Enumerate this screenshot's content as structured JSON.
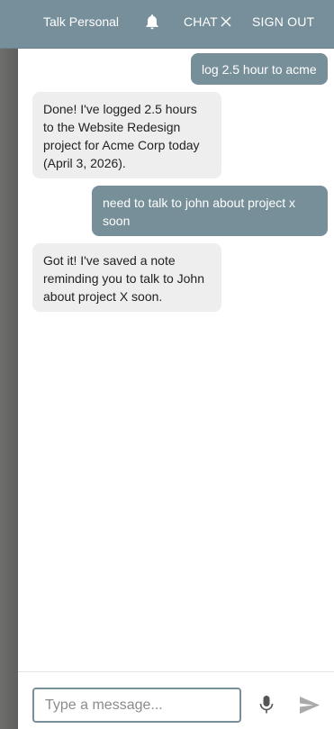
{
  "header": {
    "title": "Talk Personal",
    "notifications_icon": "bell-icon",
    "chat_label": "CHAT",
    "close_icon": "close-icon",
    "sign_out_label": "SIGN OUT"
  },
  "messages": [
    {
      "role": "user",
      "text": "log 2.5 hour to acme"
    },
    {
      "role": "assistant",
      "text": "Done! I've logged 2.5 hours to the Website Redesign project for Acme Corp today (April 3, 2026)."
    },
    {
      "role": "user",
      "text": "need to talk to john about project x soon"
    },
    {
      "role": "assistant",
      "text": "Got it! I've saved a note reminding you to talk to John about project X soon."
    }
  ],
  "composer": {
    "placeholder": "Type a message...",
    "value": "",
    "mic_icon": "microphone-icon",
    "send_icon": "send-icon"
  },
  "colors": {
    "header_bg": "#768f9a",
    "user_bubble": "#778f99",
    "assistant_bubble": "#eeeeee",
    "panel_bg": "#ffffff",
    "side_strip": "#6b6d6b"
  }
}
